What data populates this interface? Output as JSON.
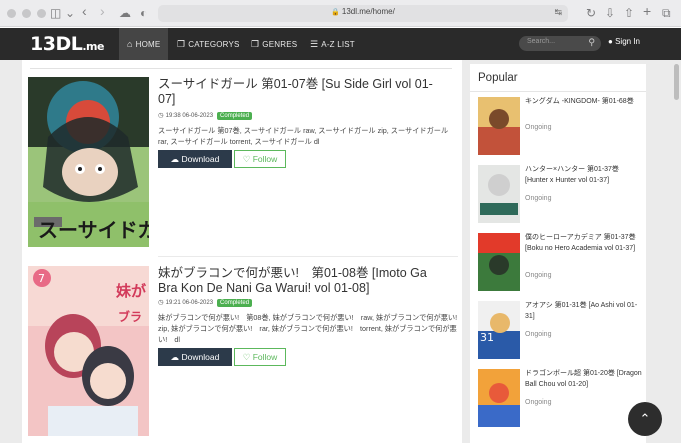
{
  "browser": {
    "url": "13dl.me/home/"
  },
  "nav": {
    "logo_main": "13DL",
    "logo_suffix": ".me",
    "links": [
      {
        "label": "HOME",
        "icon": "home-icon"
      },
      {
        "label": "CATEGORYS",
        "icon": "cube-icon"
      },
      {
        "label": "GENRES",
        "icon": "cube-icon"
      },
      {
        "label": "A-Z LIST",
        "icon": "list-icon"
      }
    ],
    "search_placeholder": "Search...",
    "signin": "Sign In"
  },
  "items": [
    {
      "title": "スーサイドガール 第01-07巻 [Su Side Girl vol 01-07]",
      "date": "19:38 06-06-2023",
      "status": "Completed",
      "description": "スーサイドガール 第07巻, スーサイドガール raw, スーサイドガール zip, スーサイドガール rar, スーサイドガール torrent, スーサイドガール dl",
      "download_label": "Download",
      "follow_label": "Follow"
    },
    {
      "title": "妹がブラコンで何が悪い!　第01-08巻 [Imoto Ga Bra Kon De Nani Ga Warui! vol 01-08]",
      "date": "19:21 06-06-2023",
      "status": "Completed",
      "description": "妹がブラコンで何が悪い!　第08巻, 妹がブラコンで何が悪い!　raw, 妹がブラコンで何が悪い!　zip, 妹がブラコンで何が悪い!　rar, 妹がブラコンで何が悪い!　torrent, 妹がブラコンで何が悪い!　dl",
      "download_label": "Download",
      "follow_label": "Follow"
    }
  ],
  "sidebar": {
    "heading": "Popular",
    "items": [
      {
        "title": "キングダム -KINGDOM- 第01-68巻",
        "status": "Ongoing"
      },
      {
        "title": "ハンター×ハンター 第01-37巻 [Hunter x Hunter vol 01-37]",
        "status": "Ongoing"
      },
      {
        "title": "僕のヒーローアカデミア 第01-37巻 [Boku no Hero Academia vol 01-37]",
        "status": "Ongoing"
      },
      {
        "title": "アオアシ 第01-31巻 [Ao Ashi vol 01-31]",
        "status": "Ongoing"
      },
      {
        "title": "ドラゴンボール超 第01-20巻 [Dragon Ball Chou vol 01-20]",
        "status": "Ongoing"
      }
    ]
  },
  "colors": {
    "nav_bg": "#2a2a2a",
    "completed": "#4caf50",
    "follow": "#5cb85c",
    "download_bg": "#2c3a4a"
  }
}
